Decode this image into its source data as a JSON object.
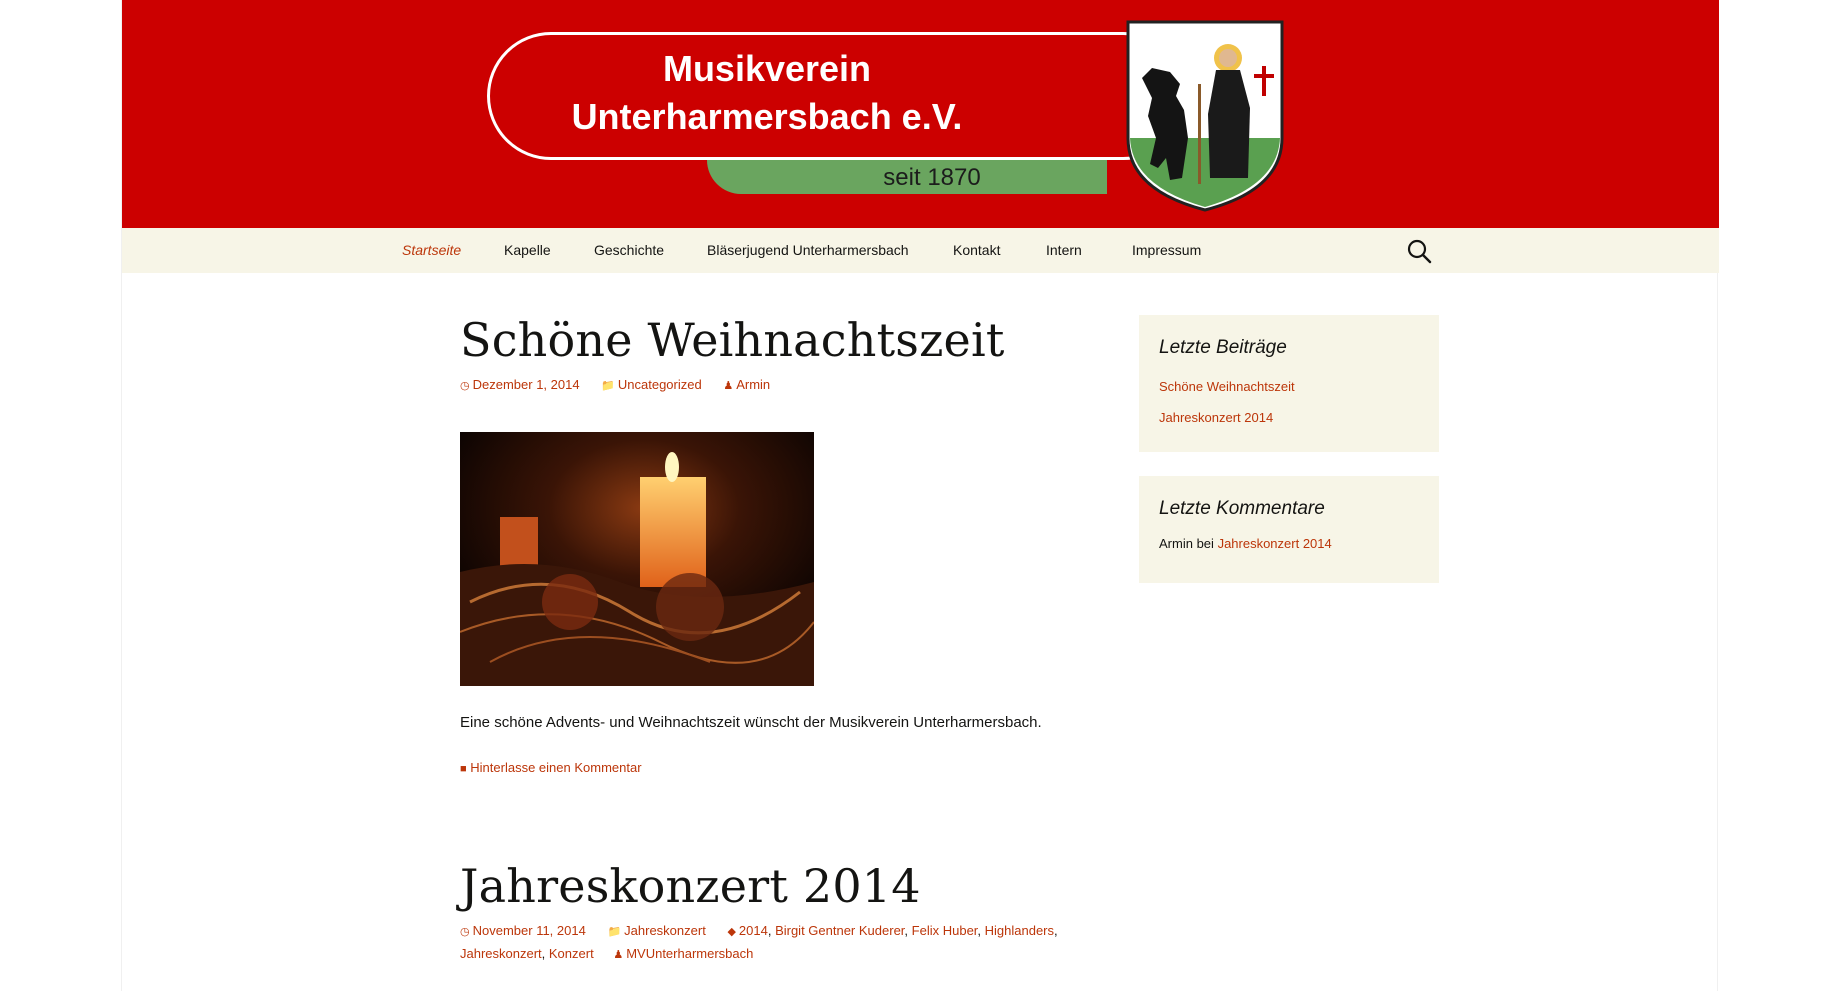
{
  "header": {
    "title_line1": "Musikverein",
    "title_line2": "Unterharmersbach e.V.",
    "since": "seit 1870",
    "colors": {
      "header_bg": "#cc0000",
      "band_green": "#6aa55f",
      "nav_bg": "#f7f5e7",
      "link": "#bc360a"
    }
  },
  "nav": {
    "items": [
      {
        "label": "Startseite",
        "active": true
      },
      {
        "label": "Kapelle"
      },
      {
        "label": "Geschichte"
      },
      {
        "label": "Bläserjugend Unterharmersbach"
      },
      {
        "label": "Kontakt"
      },
      {
        "label": "Intern"
      },
      {
        "label": "Impressum"
      }
    ],
    "search_icon": "search-icon"
  },
  "posts": [
    {
      "title": "Schöne Weihnachtszeit",
      "date": "Dezember 1, 2014",
      "category": "Uncategorized",
      "author": "Armin",
      "excerpt": "Eine schöne Advents- und Weihnachtszeit wünscht der Musikverein Unterharmersbach.",
      "comment_link": "Hinterlasse einen Kommentar"
    },
    {
      "title": "Jahreskonzert 2014",
      "date": "November 11, 2014",
      "category": "Jahreskonzert",
      "tags": [
        "2014",
        "Birgit Gentner Kuderer",
        "Felix Huber",
        "Highlanders",
        "Jahreskonzert",
        "Konzert"
      ],
      "author": "MVUnterharmersbach"
    }
  ],
  "sidebar": {
    "recent_posts": {
      "title": "Letzte Beiträge",
      "items": [
        "Schöne Weihnachtszeit",
        "Jahreskonzert 2014"
      ]
    },
    "recent_comments": {
      "title": "Letzte Kommentare",
      "author": "Armin",
      "connector": "bei",
      "post": "Jahreskonzert 2014"
    }
  }
}
